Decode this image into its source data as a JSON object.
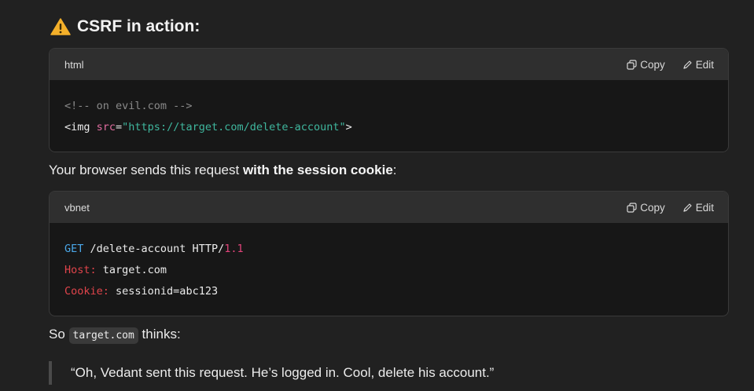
{
  "heading": {
    "icon": "warning-icon",
    "text": "CSRF in action:"
  },
  "block1": {
    "lang": "html",
    "copy_label": "Copy",
    "edit_label": "Edit",
    "line1": "<!-- on evil.com -->",
    "line2_tag": "<img ",
    "line2_attr": "src",
    "line2_eq": "=",
    "line2_str": "\"https://target.com/delete-account\"",
    "line2_end": ">"
  },
  "para1": {
    "prefix": "Your browser sends this request ",
    "bold": "with the session cookie",
    "suffix": ":"
  },
  "block2": {
    "lang": "vbnet",
    "copy_label": "Copy",
    "edit_label": "Edit",
    "method": "GET",
    "path": " /delete-account HTTP/",
    "version": "1.1",
    "host_key": "Host:",
    "host_val": " target.com",
    "cookie_key": "Cookie:",
    "cookie_val": " sessionid=abc123"
  },
  "para2": {
    "prefix": "So ",
    "code": "target.com",
    "suffix": " thinks:"
  },
  "quote": "“Oh, Vedant sent this request. He’s logged in. Cool, delete his account.”",
  "colors": {
    "background": "#212121",
    "code_bg": "#171717",
    "header_bg": "#2f2f2f"
  }
}
